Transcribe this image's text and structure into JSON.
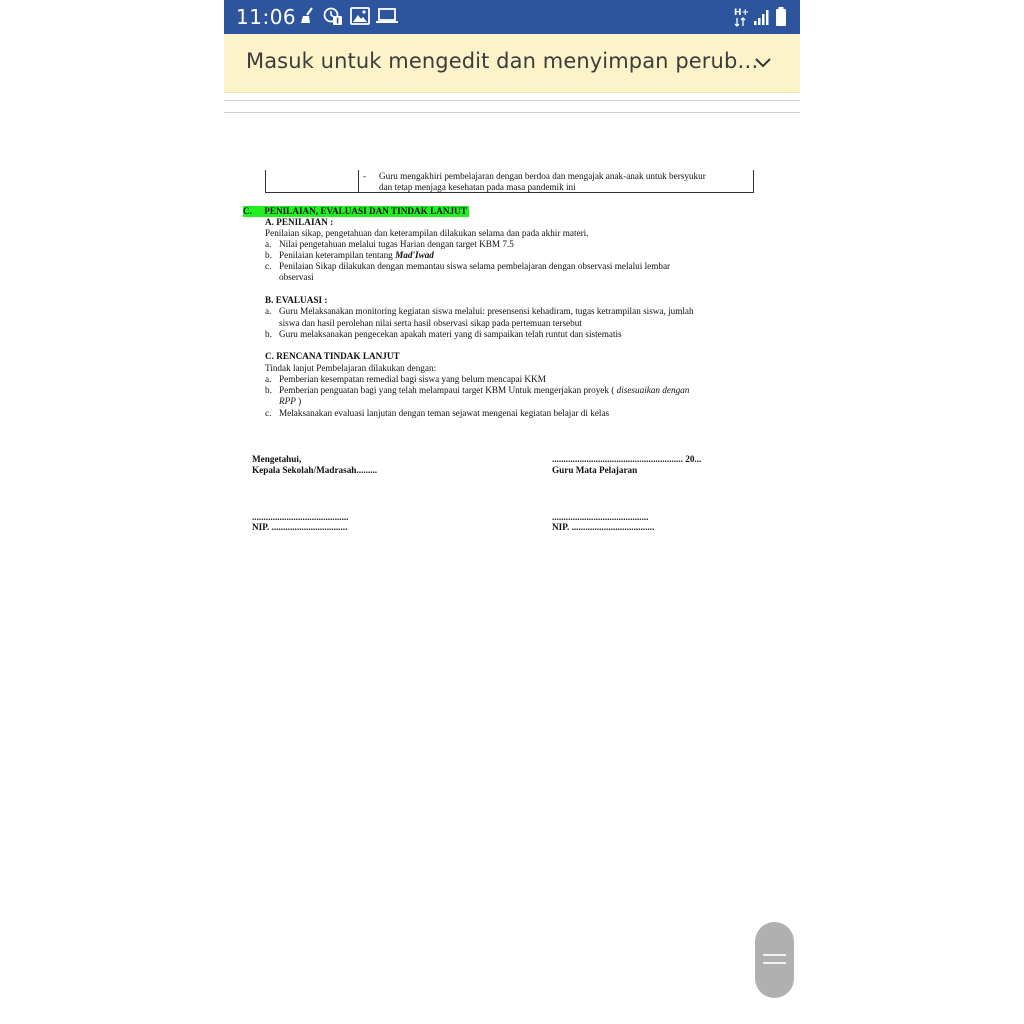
{
  "status_bar": {
    "time": "11:06",
    "left_icons": [
      "broom-icon",
      "alarm-badge-icon",
      "image-icon",
      "laptop-icon"
    ],
    "right_icons": [
      "data-hplus-icon",
      "signal-icon",
      "battery-icon"
    ],
    "network_label": "H+",
    "background": "#2d559d"
  },
  "banner": {
    "text": "Masuk untuk mengedit dan menyimpan perub…",
    "background": "#fcf4c8",
    "expand_icon": "chevron-down-icon"
  },
  "document": {
    "table_row": {
      "dash": "-",
      "line1": "Guru mengakhiri pembelajaran dengan berdoa dan mengajak anak-anak untuk bersyukur",
      "line2": "dan tetap menjaga kesehatan pada masa pandemik ini"
    },
    "section_c": {
      "marker": "C.",
      "title": "PENILAIAN, EVALUASI DAN TINDAK LANJUT",
      "highlight": "#22f022"
    },
    "penilaian": {
      "heading": "A. PENILAIAN :",
      "intro": "Penilaian sikap, pengetahuan dan keterampilan dilakukan selama dan pada akhir materi.",
      "a": "Nilai pengetahuan melalui tugas Harian dengan target KBM 7.5",
      "b_prefix": "Penilaian keterampilan tentang ",
      "b_emph": "Mad'Iwad",
      "c_line1": "Penilaian Sikap dilakukan dengan memantau siswa selama pembelajaran dengan observasi melalui lembar",
      "c_line2": "observasi"
    },
    "evaluasi": {
      "heading": "B. EVALUASI :",
      "a_line1": "Guru Melaksanakan monitoring kegiatan siswa melalui: presensensi kehadiram, tugas ketrampilan siswa, jumlah",
      "a_line2": "siswa dan hasil perolehan nilai serta hasil observasi sikap pada pertemuan tersebut",
      "b": "Guru melaksanakan pengecekan apakah materi yang di sampaikan telah runtut dan sistematis"
    },
    "rencana": {
      "heading": "C. RENCANA TINDAK LANJUT",
      "intro": "Tindak lanjut Pembelajaran dilakukan dengan:",
      "a": "Pemberian kesempatan remedial bagi siswa yang belum mencapai KKM",
      "b_prefix": "Pemberian penguatan bagi yang telah melampaui target KBM Untuk mengerjakan proyek ( ",
      "b_emph": "disesuaikan dengan",
      "b_line2_emph": "RPP",
      "b_line2_rest": " )",
      "c": "Melaksanakan evaluasi lanjutan dengan teman sejawat mengenai kegiatan belajar di kelas"
    },
    "markers": {
      "a": "a.",
      "b": "b.",
      "c": "c."
    },
    "signature": {
      "left_line1": "Mengetahui,",
      "left_line2": "Kepala Sekolah/Madrasah.........",
      "right_line1": "......................................................... 20...",
      "right_line2": "Guru Mata Pelajaran",
      "left_blank": "..........................................",
      "left_nip": "NIP. .................................",
      "right_blank": "..........................................",
      "right_nip": "NIP. ...................................."
    }
  },
  "scroll_handle": {
    "icon": "scroll-handle-icon"
  }
}
